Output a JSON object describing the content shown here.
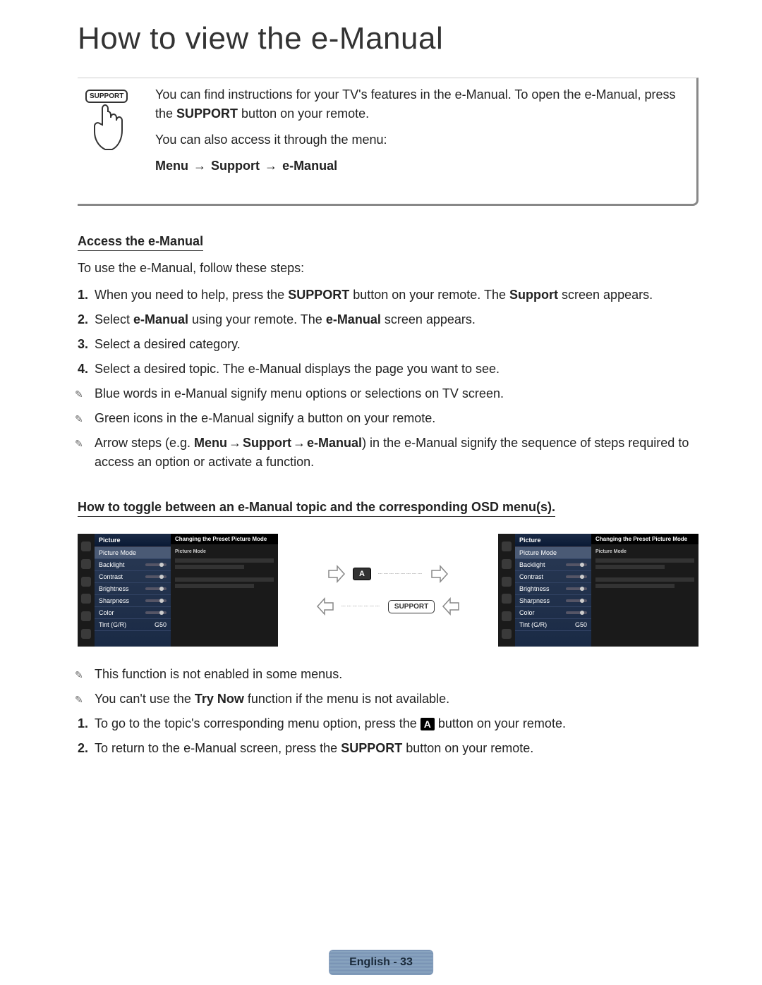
{
  "title": "How to view the e-Manual",
  "intro": {
    "support_label": "SUPPORT",
    "p1_a": "You can find instructions for your TV's features in the e-Manual. To open the e-Manual, press the ",
    "p1_b": "SUPPORT",
    "p1_c": " button on your remote.",
    "p2": "You can also access it through the menu:",
    "path_menu": "Menu",
    "path_support": "Support",
    "path_emanual": "e-Manual"
  },
  "section1": {
    "heading": "Access the e-Manual",
    "intro": "To use the e-Manual, follow these steps:",
    "steps": [
      {
        "num": "1.",
        "parts": [
          "When you need to help, press the ",
          "SUPPORT",
          " button on your remote. The ",
          "Support",
          " screen appears."
        ]
      },
      {
        "num": "2.",
        "parts": [
          "Select ",
          "e-Manual",
          " using your remote. The ",
          "e-Manual",
          " screen appears."
        ]
      },
      {
        "num": "3.",
        "parts": [
          "Select a desired category."
        ]
      },
      {
        "num": "4.",
        "parts": [
          "Select a desired topic. The e-Manual displays the page you want to see."
        ]
      }
    ],
    "notes": [
      "Blue words in e-Manual signify menu options or selections on TV screen.",
      "Green icons in the e-Manual signify a button on your remote."
    ],
    "note3_a": "Arrow steps (e.g. ",
    "note3_menu": "Menu",
    "note3_support": "Support",
    "note3_emanual": "e-Manual",
    "note3_b": ") in the e-Manual signify the sequence of steps required to access an option or activate a function."
  },
  "section2": {
    "heading": "How to toggle between an e-Manual topic and the corresponding OSD menu(s).",
    "osd_left": {
      "header": "Picture",
      "items": [
        "Picture Mode",
        "Backlight",
        "Contrast",
        "Brightness",
        "Sharpness",
        "Color",
        "Tint (G/R)"
      ],
      "tint_value": "G50",
      "right_header": "Changing the Preset Picture Mode",
      "right_sub": "Picture Mode"
    },
    "middle": {
      "a_label": "A",
      "support_label": "SUPPORT"
    },
    "osd_right": {
      "header": "Picture",
      "items": [
        "Picture Mode",
        "Backlight",
        "Contrast",
        "Brightness",
        "Sharpness",
        "Color",
        "Tint (G/R)"
      ],
      "tint_value": "G50",
      "right_header": "Changing the Preset Picture Mode",
      "right_sub": "Picture Mode"
    },
    "notes": [
      "This function is not enabled in some menus."
    ],
    "note2_a": "You can't use the ",
    "note2_b": "Try Now",
    "note2_c": " function if the menu is not available.",
    "step1_a": "To go to the topic's corresponding menu option, press the ",
    "step1_b": " button on your remote.",
    "step1_a_label": "A",
    "step2_a": "To return to the e-Manual screen, press the ",
    "step2_b": "SUPPORT",
    "step2_c": " button on your remote."
  },
  "footer": "English - 33"
}
